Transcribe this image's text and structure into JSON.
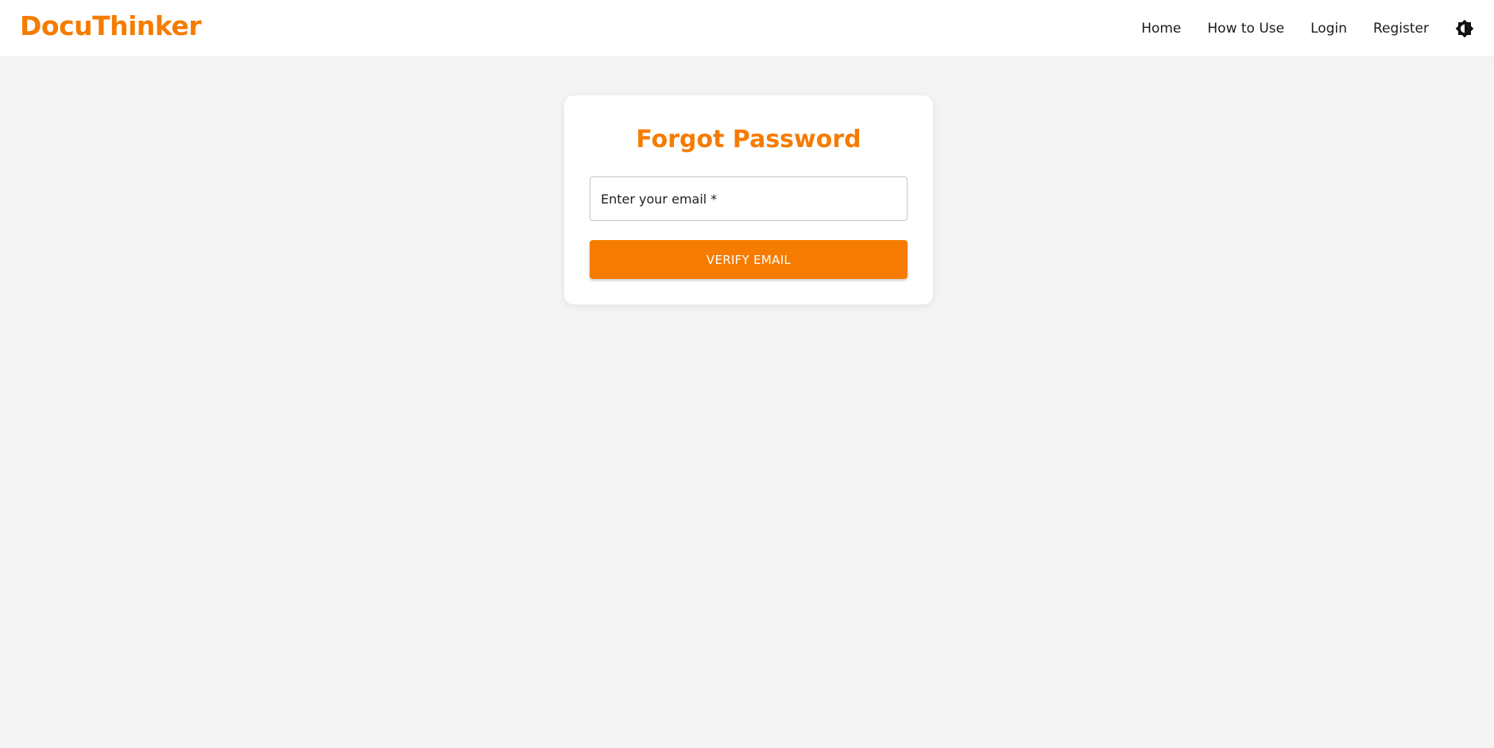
{
  "header": {
    "brand": "DocuThinker",
    "nav": [
      "Home",
      "How to Use",
      "Login",
      "Register"
    ],
    "theme_toggle_icon": "brightness-icon"
  },
  "card": {
    "title": "Forgot Password",
    "email_label": "Enter your email *",
    "button_label": "VERIFY EMAIL"
  },
  "colors": {
    "accent": "#f57c00",
    "page_background": "#f4f4f4",
    "card_background": "#ffffff"
  }
}
